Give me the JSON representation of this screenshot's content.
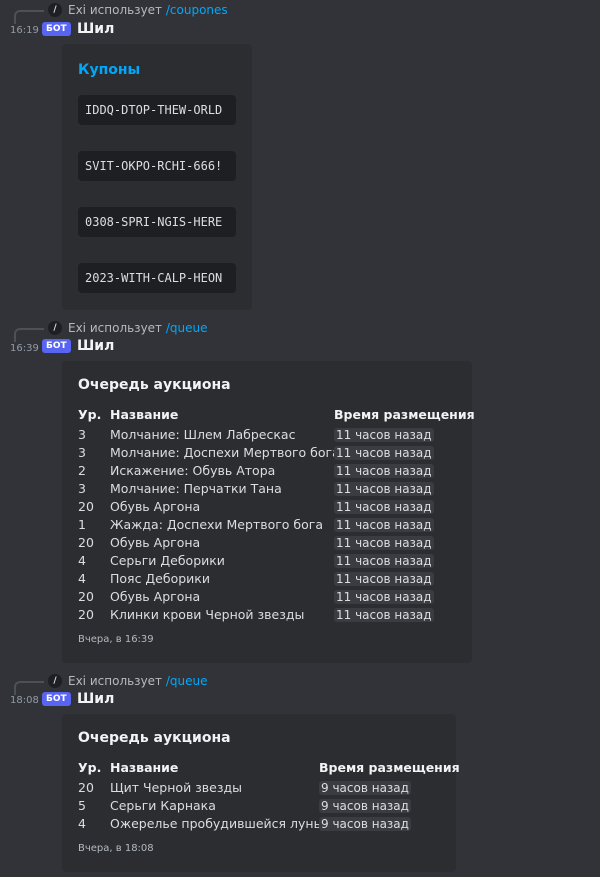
{
  "messages": [
    {
      "reply_user": "Exi",
      "reply_text": "использует",
      "command": "/coupones",
      "time": "16:19",
      "badge": "БОТ",
      "author": "Шил",
      "embed_title": "Купоны",
      "coupons": [
        "IDDQ-DTOP-THEW-ORLD",
        "SVIT-OKPO-RCHI-666!",
        "0308-SPRI-NGIS-HERE",
        "2023-WITH-CALP-HEON"
      ]
    },
    {
      "reply_user": "Exi",
      "reply_text": "использует",
      "command": "/queue",
      "time": "16:39",
      "badge": "БОТ",
      "author": "Шил",
      "embed_title": "Очередь аукциона",
      "headers": {
        "level": "Ур.",
        "name": "Название",
        "time": "Время размещения"
      },
      "rows": [
        {
          "level": "3",
          "name": "Молчание: Шлем Лабрескас",
          "time": "11 часов назад"
        },
        {
          "level": "3",
          "name": "Молчание: Доспехи Мертвого бога",
          "time": "11 часов назад"
        },
        {
          "level": "2",
          "name": "Искажение: Обувь Атора",
          "time": "11 часов назад"
        },
        {
          "level": "3",
          "name": "Молчание: Перчатки Тана",
          "time": "11 часов назад"
        },
        {
          "level": "20",
          "name": "Обувь Аргона",
          "time": "11 часов назад"
        },
        {
          "level": "1",
          "name": "Жажда: Доспехи Мертвого бога",
          "time": "11 часов назад"
        },
        {
          "level": "20",
          "name": "Обувь Аргона",
          "time": "11 часов назад"
        },
        {
          "level": "4",
          "name": "Серьги Деборики",
          "time": "11 часов назад"
        },
        {
          "level": "4",
          "name": "Пояс Деборики",
          "time": "11 часов назад"
        },
        {
          "level": "20",
          "name": "Обувь Аргона",
          "time": "11 часов назад"
        },
        {
          "level": "20",
          "name": "Клинки крови Черной звезды",
          "time": "11 часов назад"
        }
      ],
      "footer": "Вчера, в 16:39"
    },
    {
      "reply_user": "Exi",
      "reply_text": "использует",
      "command": "/queue",
      "time": "18:08",
      "badge": "БОТ",
      "author": "Шил",
      "embed_title": "Очередь аукциона",
      "headers": {
        "level": "Ур.",
        "name": "Название",
        "time": "Время размещения"
      },
      "rows": [
        {
          "level": "20",
          "name": "Щит Черной звезды",
          "time": "9 часов назад"
        },
        {
          "level": "5",
          "name": "Серьги Карнака",
          "time": "9 часов назад"
        },
        {
          "level": "4",
          "name": "Ожерелье пробудившейся луны",
          "time": "9 часов назад"
        }
      ],
      "footer": "Вчера, в 18:08"
    }
  ]
}
